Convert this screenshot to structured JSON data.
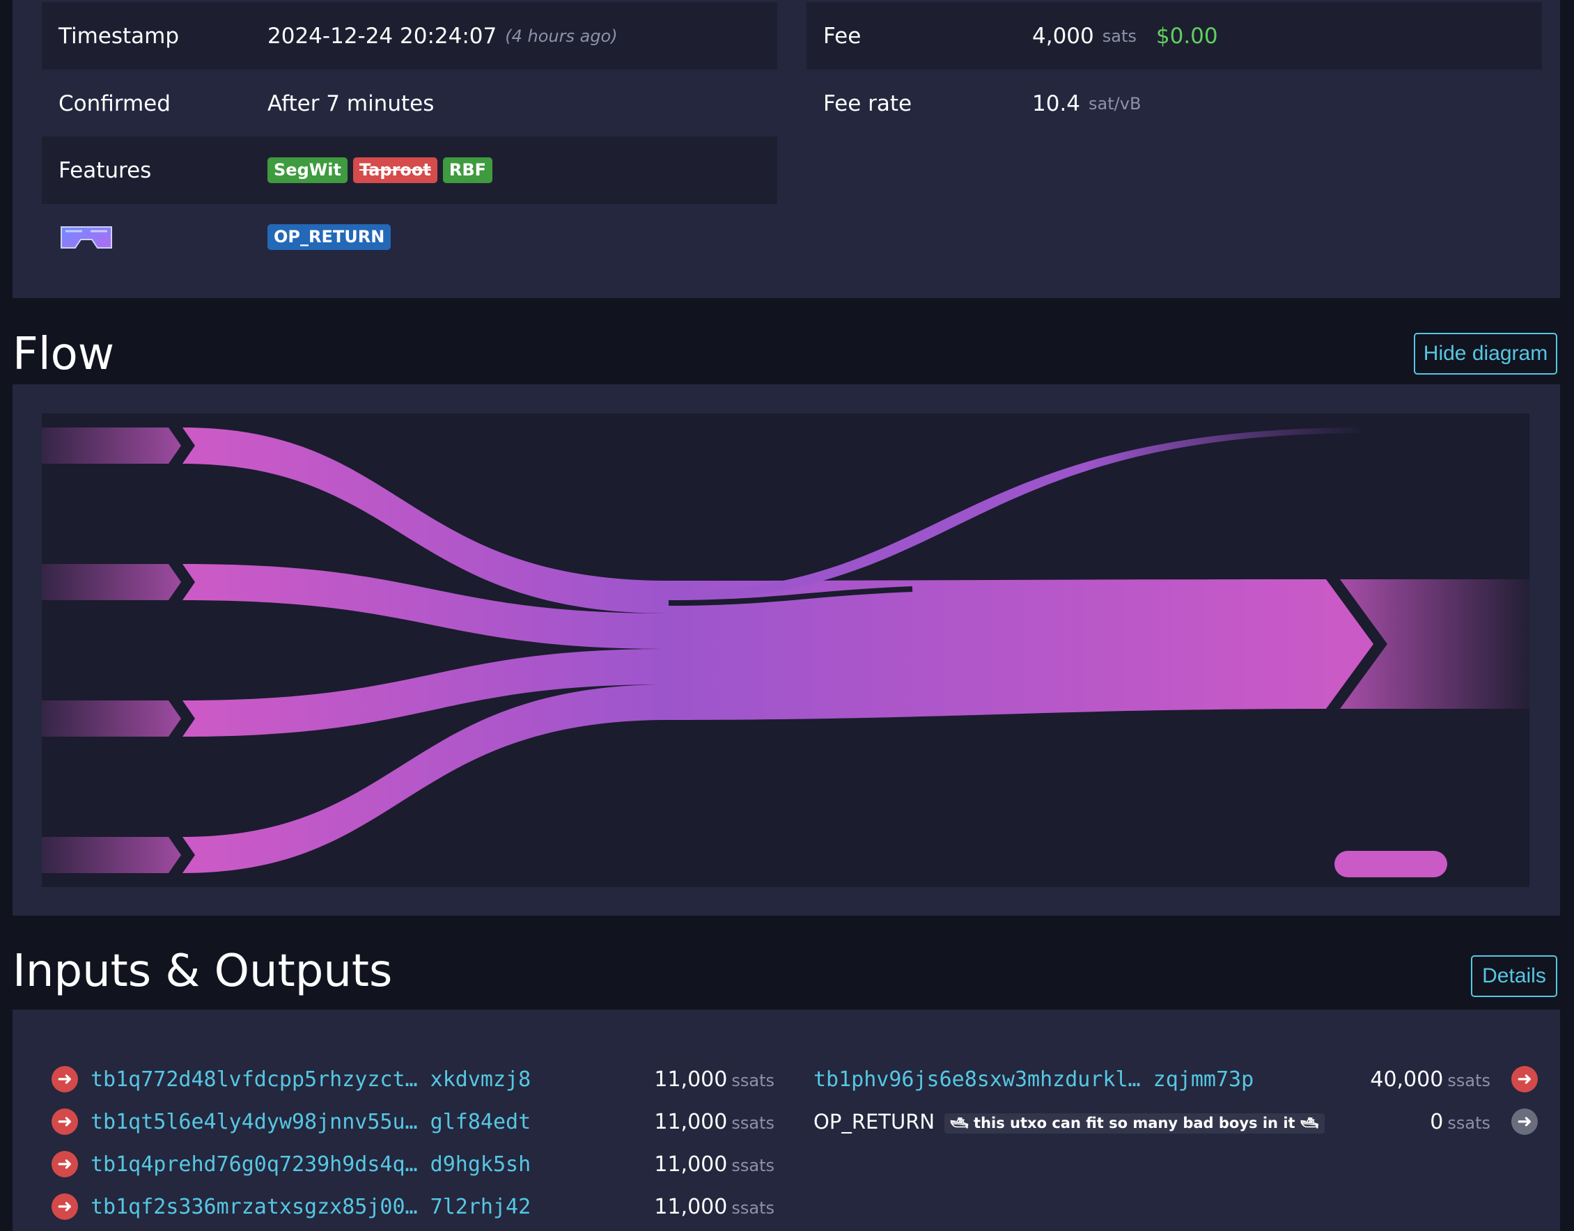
{
  "details": {
    "timestamp_label": "Timestamp",
    "timestamp_value": "2024-12-24 20:24:07",
    "timestamp_ago": "(4 hours ago)",
    "confirmed_label": "Confirmed",
    "confirmed_value": "After 7 minutes",
    "features_label": "Features",
    "features": [
      "SegWit",
      "Taproot",
      "RBF"
    ],
    "op_return_badge": "OP_RETURN",
    "fee_label": "Fee",
    "fee_amount": "4,000",
    "fee_unit": "sats",
    "fee_fiat": "$0.00",
    "fee_rate_label": "Fee rate",
    "fee_rate_value": "10.4",
    "fee_rate_unit": "sat/vB"
  },
  "flow": {
    "title": "Flow",
    "toggle_label": "Hide diagram"
  },
  "io": {
    "title": "Inputs & Outputs",
    "details_button": "Details",
    "inputs": [
      {
        "address": "tb1q772d48lvfdcpp5rhzyzct… xkdvmzj8",
        "amount": "11,000",
        "unit": "ssats"
      },
      {
        "address": "tb1qt5l6e4ly4dyw98jnnv55u… glf84edt",
        "amount": "11,000",
        "unit": "ssats"
      },
      {
        "address": "tb1q4prehd76g0q7239h9ds4q… d9hgk5sh",
        "amount": "11,000",
        "unit": "ssats"
      },
      {
        "address": "tb1qf2s336mrzatxsgzx85j00… 7l2rhj42",
        "amount": "11,000",
        "unit": "ssats"
      }
    ],
    "outputs": [
      {
        "address": "tb1phv96js6e8sxw3mhzdurkl… zqjmm73p",
        "amount": "40,000",
        "unit": "ssats"
      },
      {
        "label": "OP_RETURN",
        "message": "🛥 this utxo can fit so many bad boys in it 🛥",
        "amount": "0",
        "unit": "ssats"
      }
    ]
  },
  "colors": {
    "accent": "#56c7e3",
    "flow_pink": "#c95ac6",
    "flow_purple": "#9d55cc",
    "fiat_green": "#5fd15c"
  }
}
